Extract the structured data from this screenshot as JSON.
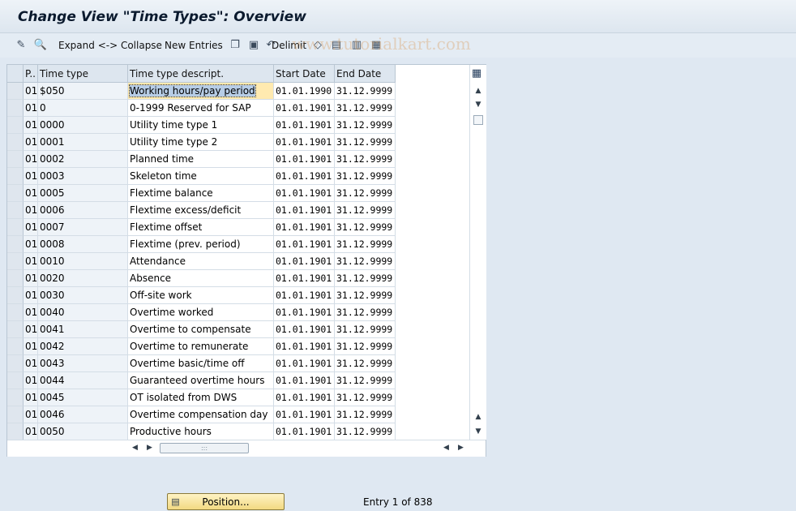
{
  "window": {
    "title": "Change View \"Time Types\": Overview"
  },
  "toolbar": {
    "expand_collapse": "Expand <-> Collapse",
    "new_entries": "New Entries",
    "delimit": "Delimit"
  },
  "watermark": "www.tutorialkart.com",
  "table": {
    "headers": {
      "p": "P..",
      "time_type": "Time type",
      "descr": "Time type descript.",
      "start": "Start Date",
      "end": "End Date"
    },
    "rows": [
      {
        "p": "01",
        "type": "$050",
        "descr": "Working hours/pay period",
        "start": "01.01.1990",
        "end": "31.12.9999"
      },
      {
        "p": "01",
        "type": "0",
        "descr": "0-1999 Reserved for SAP",
        "start": "01.01.1901",
        "end": "31.12.9999"
      },
      {
        "p": "01",
        "type": "0000",
        "descr": "Utility time type 1",
        "start": "01.01.1901",
        "end": "31.12.9999"
      },
      {
        "p": "01",
        "type": "0001",
        "descr": "Utility time type 2",
        "start": "01.01.1901",
        "end": "31.12.9999"
      },
      {
        "p": "01",
        "type": "0002",
        "descr": "Planned time",
        "start": "01.01.1901",
        "end": "31.12.9999"
      },
      {
        "p": "01",
        "type": "0003",
        "descr": "Skeleton time",
        "start": "01.01.1901",
        "end": "31.12.9999"
      },
      {
        "p": "01",
        "type": "0005",
        "descr": "Flextime balance",
        "start": "01.01.1901",
        "end": "31.12.9999"
      },
      {
        "p": "01",
        "type": "0006",
        "descr": "Flextime excess/deficit",
        "start": "01.01.1901",
        "end": "31.12.9999"
      },
      {
        "p": "01",
        "type": "0007",
        "descr": "Flextime offset",
        "start": "01.01.1901",
        "end": "31.12.9999"
      },
      {
        "p": "01",
        "type": "0008",
        "descr": "Flextime (prev. period)",
        "start": "01.01.1901",
        "end": "31.12.9999"
      },
      {
        "p": "01",
        "type": "0010",
        "descr": "Attendance",
        "start": "01.01.1901",
        "end": "31.12.9999"
      },
      {
        "p": "01",
        "type": "0020",
        "descr": "Absence",
        "start": "01.01.1901",
        "end": "31.12.9999"
      },
      {
        "p": "01",
        "type": "0030",
        "descr": "Off-site work",
        "start": "01.01.1901",
        "end": "31.12.9999"
      },
      {
        "p": "01",
        "type": "0040",
        "descr": "Overtime worked",
        "start": "01.01.1901",
        "end": "31.12.9999"
      },
      {
        "p": "01",
        "type": "0041",
        "descr": "Overtime to compensate",
        "start": "01.01.1901",
        "end": "31.12.9999"
      },
      {
        "p": "01",
        "type": "0042",
        "descr": "Overtime to remunerate",
        "start": "01.01.1901",
        "end": "31.12.9999"
      },
      {
        "p": "01",
        "type": "0043",
        "descr": "Overtime basic/time off",
        "start": "01.01.1901",
        "end": "31.12.9999"
      },
      {
        "p": "01",
        "type": "0044",
        "descr": "Guaranteed overtime hours",
        "start": "01.01.1901",
        "end": "31.12.9999"
      },
      {
        "p": "01",
        "type": "0045",
        "descr": "OT isolated from DWS",
        "start": "01.01.1901",
        "end": "31.12.9999"
      },
      {
        "p": "01",
        "type": "0046",
        "descr": "Overtime compensation day",
        "start": "01.01.1901",
        "end": "31.12.9999"
      },
      {
        "p": "01",
        "type": "0050",
        "descr": "Productive hours",
        "start": "01.01.1901",
        "end": "31.12.9999"
      }
    ]
  },
  "footer": {
    "position_button": "Position...",
    "entry_info": "Entry 1 of 838"
  }
}
